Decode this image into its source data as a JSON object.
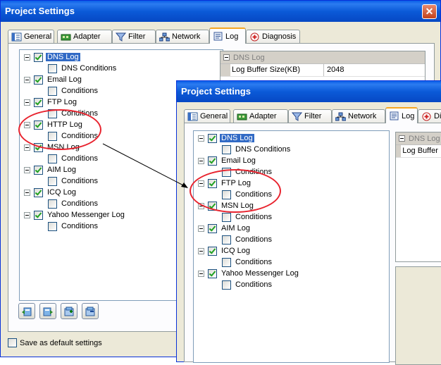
{
  "back_window": {
    "title": "Project Settings",
    "close_label": "✕",
    "tabs": [
      {
        "label": "General",
        "icon": "general-icon"
      },
      {
        "label": "Adapter",
        "icon": "adapter-icon"
      },
      {
        "label": "Filter",
        "icon": "filter-icon"
      },
      {
        "label": "Network",
        "icon": "network-icon"
      },
      {
        "label": "Log",
        "icon": "log-icon",
        "active": true
      },
      {
        "label": "Diagnosis",
        "icon": "diagnosis-icon"
      }
    ],
    "tree": [
      {
        "label": "DNS Log",
        "level": 0,
        "checked": true,
        "selected": true
      },
      {
        "label": "DNS Conditions",
        "level": 1,
        "checked": false
      },
      {
        "label": "Email Log",
        "level": 0,
        "checked": true
      },
      {
        "label": "Conditions",
        "level": 1,
        "checked": false
      },
      {
        "label": "FTP Log",
        "level": 0,
        "checked": true
      },
      {
        "label": "Conditions",
        "level": 1,
        "checked": false
      },
      {
        "label": "HTTP Log",
        "level": 0,
        "checked": true
      },
      {
        "label": "Conditions",
        "level": 1,
        "checked": false
      },
      {
        "label": "MSN Log",
        "level": 0,
        "checked": true
      },
      {
        "label": "Conditions",
        "level": 1,
        "checked": false
      },
      {
        "label": "AIM Log",
        "level": 0,
        "checked": true
      },
      {
        "label": "Conditions",
        "level": 1,
        "checked": false
      },
      {
        "label": "ICQ Log",
        "level": 0,
        "checked": true
      },
      {
        "label": "Conditions",
        "level": 1,
        "checked": false
      },
      {
        "label": "Yahoo Messenger Log",
        "level": 0,
        "checked": true
      },
      {
        "label": "Conditions",
        "level": 1,
        "checked": false
      }
    ],
    "property_header": "DNS Log",
    "property_rows": [
      {
        "key": "Log Buffer Size(KB)",
        "value": "2048"
      }
    ],
    "save_default_label": "Save as default settings"
  },
  "front_window": {
    "title": "Project Settings",
    "tabs": [
      {
        "label": "General",
        "icon": "general-icon"
      },
      {
        "label": "Adapter",
        "icon": "adapter-icon"
      },
      {
        "label": "Filter",
        "icon": "filter-icon"
      },
      {
        "label": "Network",
        "icon": "network-icon"
      },
      {
        "label": "Log",
        "icon": "log-icon",
        "active": true
      },
      {
        "label": "Di",
        "icon": "diagnosis-icon"
      }
    ],
    "tree": [
      {
        "label": "DNS Log",
        "level": 0,
        "checked": true,
        "selected": true
      },
      {
        "label": "DNS Conditions",
        "level": 1,
        "checked": false
      },
      {
        "label": "Email Log",
        "level": 0,
        "checked": true
      },
      {
        "label": "Conditions",
        "level": 1,
        "checked": false
      },
      {
        "label": "FTP Log",
        "level": 0,
        "checked": true
      },
      {
        "label": "Conditions",
        "level": 1,
        "checked": false
      },
      {
        "label": "MSN Log",
        "level": 0,
        "checked": true
      },
      {
        "label": "Conditions",
        "level": 1,
        "checked": false
      },
      {
        "label": "AIM Log",
        "level": 0,
        "checked": true
      },
      {
        "label": "Conditions",
        "level": 1,
        "checked": false
      },
      {
        "label": "ICQ Log",
        "level": 0,
        "checked": true
      },
      {
        "label": "Conditions",
        "level": 1,
        "checked": false
      },
      {
        "label": "Yahoo Messenger Log",
        "level": 0,
        "checked": true
      },
      {
        "label": "Conditions",
        "level": 1,
        "checked": false
      }
    ],
    "property_header": "DNS Log",
    "property_rows": [
      {
        "key": "Log Buffer",
        "value": ""
      }
    ]
  },
  "toolbar_icons": [
    "import-icon",
    "export-icon",
    "add-icon",
    "remove-icon"
  ],
  "colors": {
    "annotation": "#e8232e",
    "titlebar": "#0a5ee8",
    "selection": "#316ac5",
    "check": "#21a121"
  }
}
